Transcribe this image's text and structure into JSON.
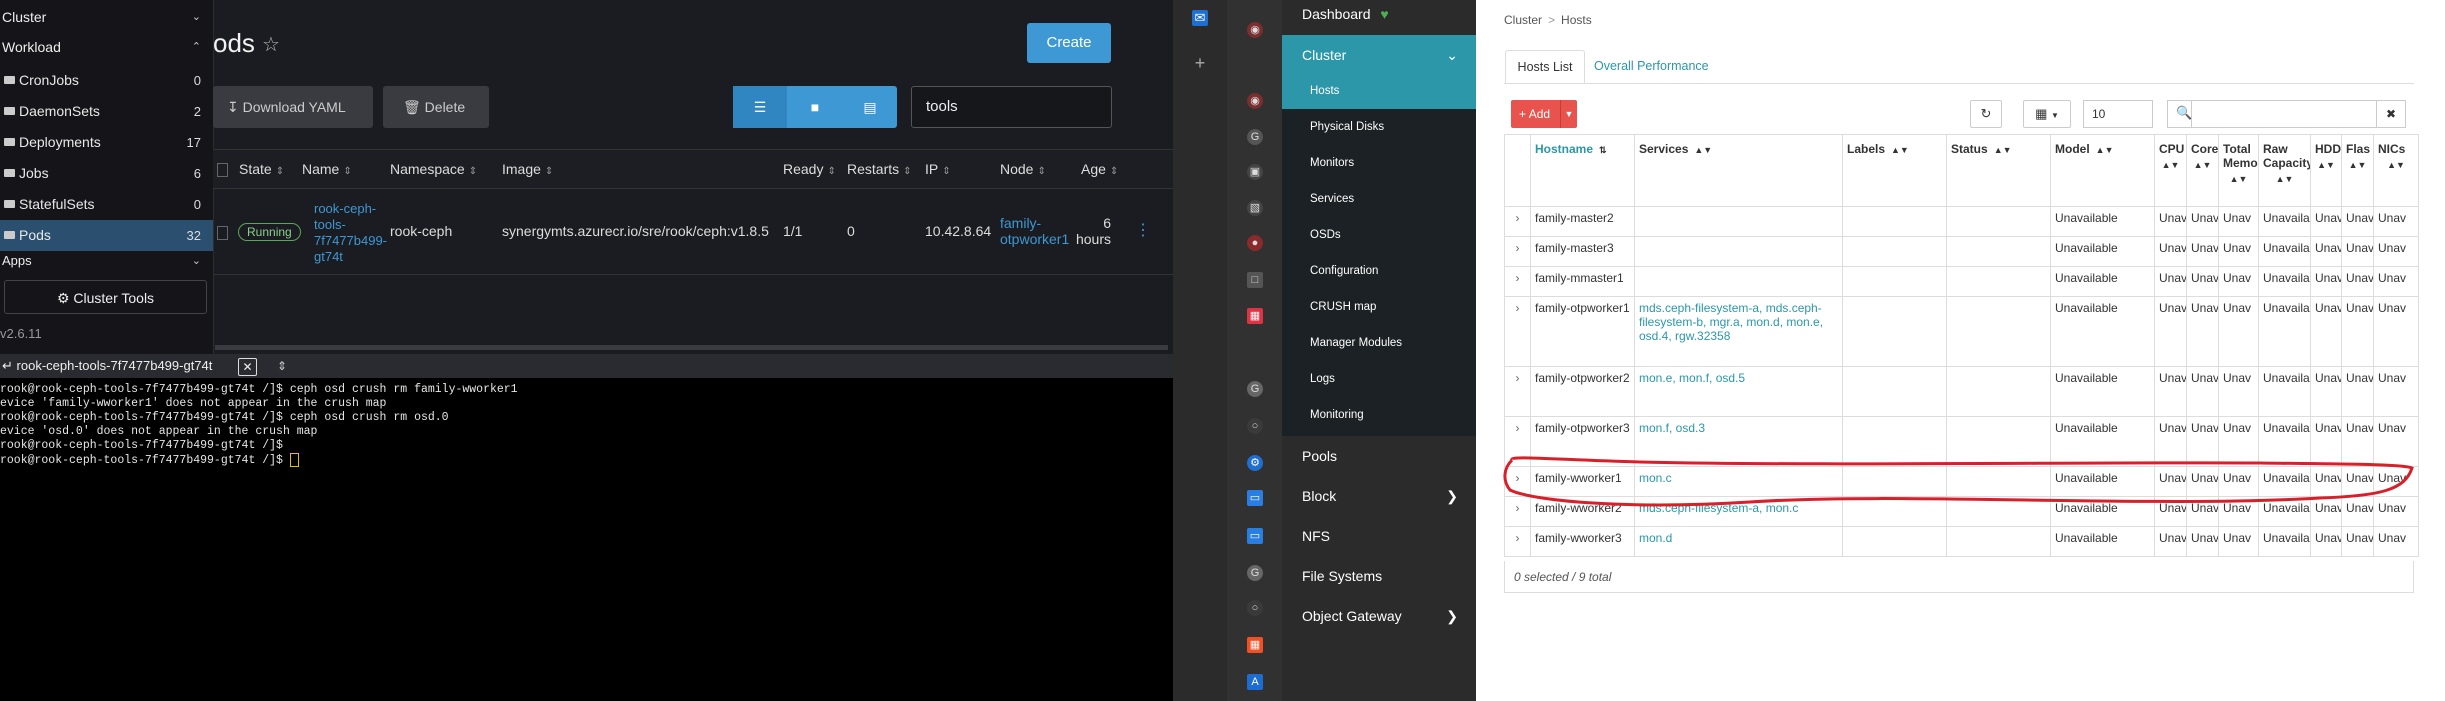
{
  "rancher": {
    "sidebar": {
      "groups": [
        {
          "label": "Cluster"
        },
        {
          "label": "Workload"
        }
      ],
      "items": [
        {
          "label": "CronJobs",
          "count": "0"
        },
        {
          "label": "DaemonSets",
          "count": "2"
        },
        {
          "label": "Deployments",
          "count": "17"
        },
        {
          "label": "Jobs",
          "count": "6"
        },
        {
          "label": "StatefulSets",
          "count": "0"
        },
        {
          "label": "Pods",
          "count": "32"
        }
      ],
      "partial_item": "Apps",
      "cluster_tools": "Cluster Tools",
      "version": "v2.6.11"
    },
    "page_title": "ods",
    "create_label": "Create",
    "download_yaml_label": "Download YAML",
    "delete_label": "Delete",
    "filter_value": "tools",
    "columns": [
      "State",
      "Name",
      "Namespace",
      "Image",
      "Ready",
      "Restarts",
      "IP",
      "Node",
      "Age"
    ],
    "row": {
      "state": "Running",
      "name": "rook-ceph-tools-7f7477b499-gt74t",
      "name_lines": [
        "rook-ceph-",
        "tools-",
        "7f7477b499-",
        "gt74t"
      ],
      "namespace": "rook-ceph",
      "image": "synergymts.azurecr.io/sre/rook/ceph:v1.8.5",
      "ready": "1/1",
      "restarts": "0",
      "ip": "10.42.8.64",
      "node_lines": [
        "family-",
        "otpworker1"
      ],
      "age_lines": [
        "6",
        "hours"
      ]
    },
    "terminal": {
      "tab_label": "rook-ceph-tools-7f7477b499-gt74t",
      "lines": [
        "rook@rook-ceph-tools-7f7477b499-gt74t /]$ ceph osd crush rm family-wworker1",
        "evice 'family-wworker1' does not appear in the crush map",
        "rook@rook-ceph-tools-7f7477b499-gt74t /]$ ceph osd crush rm osd.0",
        "evice 'osd.0' does not appear in the crush map",
        "rook@rook-ceph-tools-7f7477b499-gt74t /]$",
        "rook@rook-ceph-tools-7f7477b499-gt74t /]$ "
      ]
    }
  },
  "ceph": {
    "menu": {
      "dashboard": "Dashboard",
      "cluster": "Cluster",
      "cluster_items": [
        "Hosts",
        "Physical Disks",
        "Monitors",
        "Services",
        "OSDs",
        "Configuration",
        "CRUSH map",
        "Manager Modules",
        "Logs",
        "Monitoring"
      ],
      "pools": "Pools",
      "block": "Block",
      "nfs": "NFS",
      "file_systems": "File Systems",
      "object_gateway": "Object Gateway"
    },
    "breadcrumb": [
      "Cluster",
      "Hosts"
    ],
    "tabs": [
      "Hosts List",
      "Overall Performance"
    ],
    "add_label": "Add",
    "page_size": "10",
    "columns": {
      "hostname": "Hostname",
      "services": "Services",
      "labels": "Labels",
      "status": "Status",
      "model": "Model",
      "cpu": "CPU",
      "cores": "Core",
      "memory": "Total Memo",
      "raw_capacity": "Raw Capacity",
      "hdd": "HDD",
      "flash": "Flas",
      "nics": "NICs"
    },
    "rows": [
      {
        "host": "family-master2",
        "services": "",
        "model": "Unavailable"
      },
      {
        "host": "family-master3",
        "services": "",
        "model": "Unavailable"
      },
      {
        "host": "family-mmaster1",
        "services": "",
        "model": "Unavailable"
      },
      {
        "host": "family-otpworker1",
        "services": "mds.ceph-filesystem-a, mds.ceph-filesystem-b, mgr.a, mon.d, mon.e, osd.4, rgw.32358",
        "model": "Unavailable"
      },
      {
        "host": "family-otpworker2",
        "services": "mon.e, mon.f, osd.5",
        "model": "Unavailable"
      },
      {
        "host": "family-otpworker3",
        "services": "mon.f, osd.3",
        "model": "Unavailable"
      },
      {
        "host": "family-wworker1",
        "services": "mon.c",
        "model": "Unavailable"
      },
      {
        "host": "family-wworker2",
        "services": "mds.ceph-filesystem-a, mon.c",
        "model": "Unavailable"
      },
      {
        "host": "family-wworker3",
        "services": "mon.d",
        "model": "Unavailable"
      }
    ],
    "truncated_cells": {
      "cpu": "Unav",
      "cores": "Unav",
      "memory": "Unav",
      "raw": "Unavaila",
      "hdd": "Unav",
      "flash": "Unav",
      "nics": "Unav"
    },
    "footer": "0 selected / 9 total"
  },
  "colors": {
    "accent": "#2b97a8",
    "rancher_blue": "#3d98d3",
    "add_red": "#e8534d",
    "annotation_red": "#d8202a"
  }
}
